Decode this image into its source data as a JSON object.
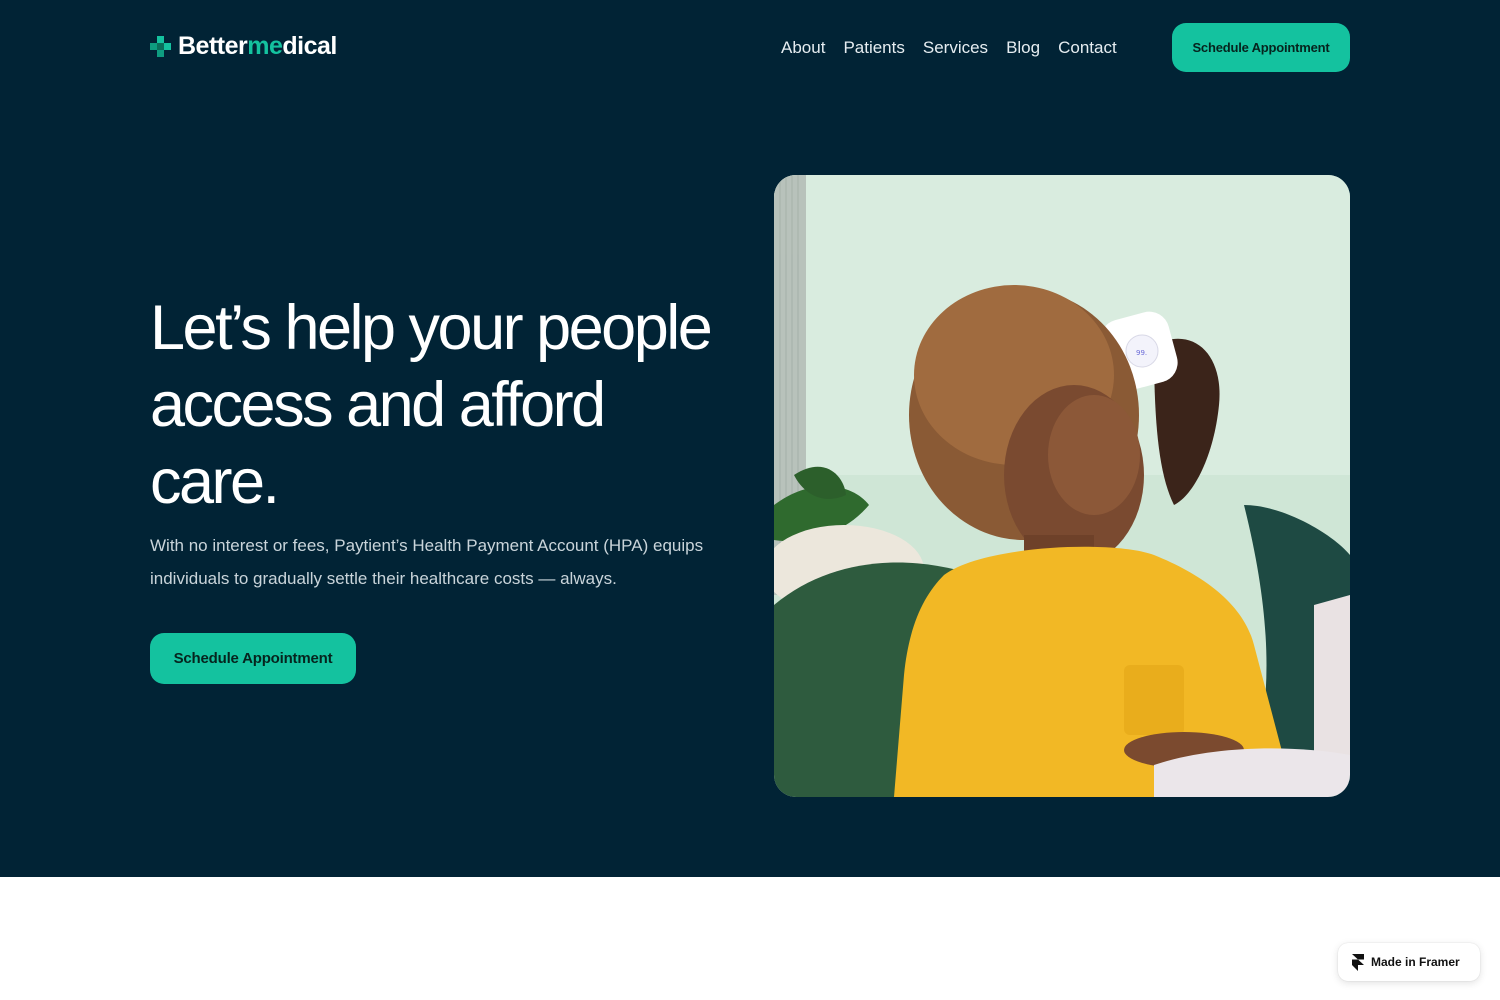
{
  "brand": {
    "name_part1": "Better",
    "name_accent": "me",
    "name_part2": "dical",
    "accent_color": "#14c29f",
    "background_color": "#012335"
  },
  "nav": {
    "items": [
      {
        "label": "About"
      },
      {
        "label": "Patients"
      },
      {
        "label": "Services"
      },
      {
        "label": "Blog"
      },
      {
        "label": "Contact"
      }
    ],
    "cta_label": "Schedule Appointment"
  },
  "hero": {
    "headline_line1": "Let’s help your people",
    "headline_line2": "access and afford",
    "headline_line3": "care.",
    "subcopy_line1": "With no interest or fees, Paytient’s Health Payment Account (HPA) equips",
    "subcopy_line2": "individuals to gradually settle their healthcare costs — always.",
    "cta_label": "Schedule Appointment",
    "image_device_reading": "99."
  },
  "badge": {
    "label": "Made in Framer",
    "icon": "framer-logo-icon"
  }
}
